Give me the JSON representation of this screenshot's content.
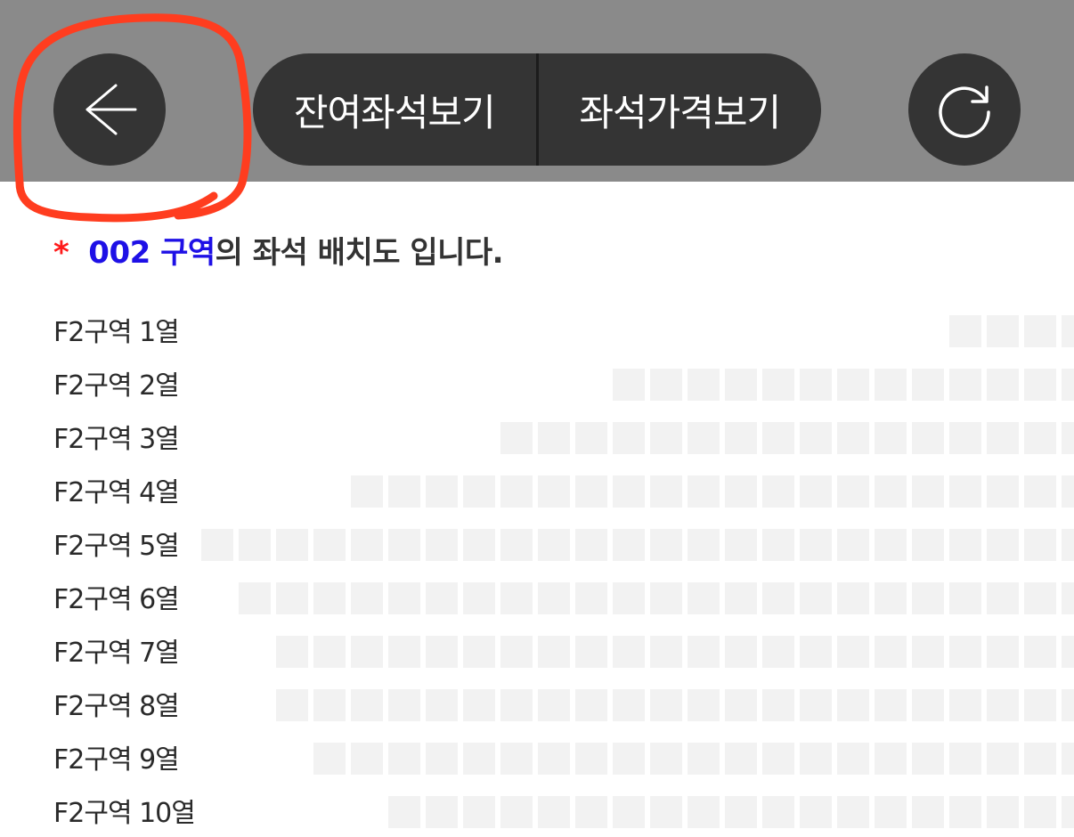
{
  "header": {
    "back_icon": "arrow-left-icon",
    "refresh_icon": "refresh-icon",
    "tabs": [
      {
        "label": "잔여좌석보기"
      },
      {
        "label": "좌석가격보기"
      }
    ],
    "colors": {
      "bar": "#8a8a8a",
      "button": "#343434",
      "annotation": "#ff3d1f"
    }
  },
  "caption": {
    "star": "*",
    "zone": "002 구역",
    "suffix": "의 좌석 배치도 입니다."
  },
  "rows": [
    {
      "label": "F2구역 1열",
      "seats": 4
    },
    {
      "label": "F2구역 2열",
      "seats": 13
    },
    {
      "label": "F2구역 3열",
      "seats": 16
    },
    {
      "label": "F2구역 4열",
      "seats": 20
    },
    {
      "label": "F2구역 5열",
      "seats": 24
    },
    {
      "label": "F2구역 6열",
      "seats": 23
    },
    {
      "label": "F2구역 7열",
      "seats": 22
    },
    {
      "label": "F2구역 8열",
      "seats": 22
    },
    {
      "label": "F2구역 9열",
      "seats": 21
    },
    {
      "label": "F2구역 10열",
      "seats": 19
    }
  ]
}
